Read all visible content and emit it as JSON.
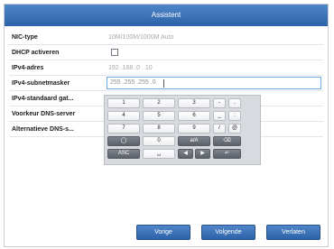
{
  "window": {
    "title": "Assistent"
  },
  "form": {
    "nic_type": {
      "label": "NIC-type",
      "value": "10M/100M/1000M Auto"
    },
    "dhcp": {
      "label": "DHCP activeren",
      "checked": false
    },
    "ipv4_address": {
      "label": "IPv4-adres",
      "value": "192 .168 .0 . 10"
    },
    "ipv4_subnet": {
      "label": "IPv4-subnetmasker",
      "value": "255 .255 .255 .0"
    },
    "ipv4_gateway": {
      "label": "IPv4-standaard gat..."
    },
    "preferred_dns": {
      "label": "Voorkeur DNS-server"
    },
    "alternate_dns": {
      "label": "Alternatieve DNS-s..."
    }
  },
  "keypad": {
    "rows": [
      [
        "1",
        "2",
        "3",
        "-",
        "."
      ],
      [
        "4",
        "5",
        "6",
        "_",
        ":"
      ],
      [
        "7",
        "8",
        "9",
        "/",
        "@"
      ],
      [
        "globe-icon",
        "0",
        "a/A",
        "backspace-icon"
      ],
      [
        "ASC",
        "space-icon",
        "left-arrow-icon",
        "right-arrow-icon",
        "enter-icon"
      ]
    ],
    "labels": {
      "k1": "1",
      "k2": "2",
      "k3": "3",
      "k_dash": "-",
      "k_dot": ".",
      "k4": "4",
      "k5": "5",
      "k6": "6",
      "k_underscore": "_",
      "k_colon": ":",
      "k7": "7",
      "k8": "8",
      "k9": "9",
      "k_slash": "/",
      "k_at": "@",
      "k0": "0",
      "k_case": "a/A",
      "k_asc": "ASC"
    }
  },
  "footer": {
    "prev_label": "Vorige",
    "next_label": "Volgende",
    "exit_label": "Verlaten"
  },
  "colors": {
    "title_bar": "#2d62a8",
    "button": "#2d62a8",
    "active_input_border": "#6da9e3"
  }
}
